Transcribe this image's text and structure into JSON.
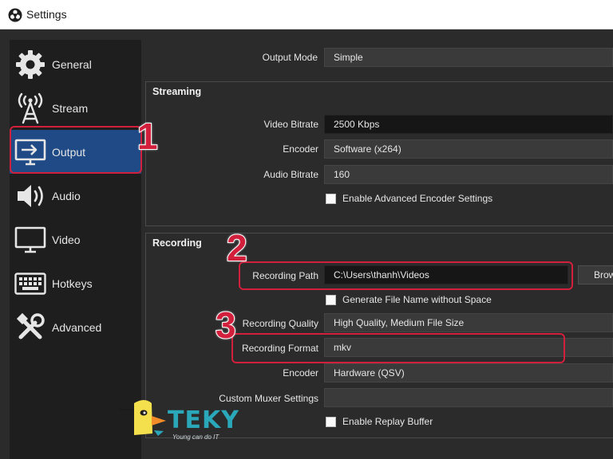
{
  "window": {
    "title": "Settings",
    "icon": "obs-logo-icon"
  },
  "sidebar": {
    "items": [
      {
        "label": "General",
        "icon": "gear-icon"
      },
      {
        "label": "Stream",
        "icon": "broadcast-tower-icon"
      },
      {
        "label": "Output",
        "icon": "output-monitor-icon",
        "selected": true
      },
      {
        "label": "Audio",
        "icon": "speaker-icon"
      },
      {
        "label": "Video",
        "icon": "monitor-icon"
      },
      {
        "label": "Hotkeys",
        "icon": "keyboard-icon"
      },
      {
        "label": "Advanced",
        "icon": "tools-icon"
      }
    ]
  },
  "output_mode": {
    "label": "Output Mode",
    "value": "Simple"
  },
  "streaming": {
    "title": "Streaming",
    "video_bitrate": {
      "label": "Video Bitrate",
      "value": "2500 Kbps"
    },
    "encoder": {
      "label": "Encoder",
      "value": "Software (x264)"
    },
    "audio_bitrate": {
      "label": "Audio Bitrate",
      "value": "160"
    },
    "advanced_encoder": {
      "label": "Enable Advanced Encoder Settings",
      "checked": false
    }
  },
  "recording": {
    "title": "Recording",
    "path": {
      "label": "Recording Path",
      "value": "C:\\Users\\thanh\\Videos"
    },
    "browse_label": "Brow",
    "generate_filename": {
      "label": "Generate File Name without Space",
      "checked": false
    },
    "quality": {
      "label": "Recording Quality",
      "value": "High Quality, Medium File Size"
    },
    "format": {
      "label": "Recording Format",
      "value": "mkv"
    },
    "encoder": {
      "label": "Encoder",
      "value": "Hardware (QSV)"
    },
    "muxer": {
      "label": "Custom Muxer Settings",
      "value": ""
    },
    "replay_buffer": {
      "label": "Enable Replay Buffer",
      "checked": false
    }
  },
  "annotations": {
    "step1": "1",
    "step2": "2",
    "step3": "3",
    "color": "#d21f3c"
  },
  "watermark": {
    "brand": "TEKY",
    "slogan": "Young can do IT"
  },
  "colors": {
    "selected": "#1f4a86",
    "background": "#2b2b2b",
    "sidebar": "#1e1e1e",
    "accent": "#d21f3c"
  }
}
